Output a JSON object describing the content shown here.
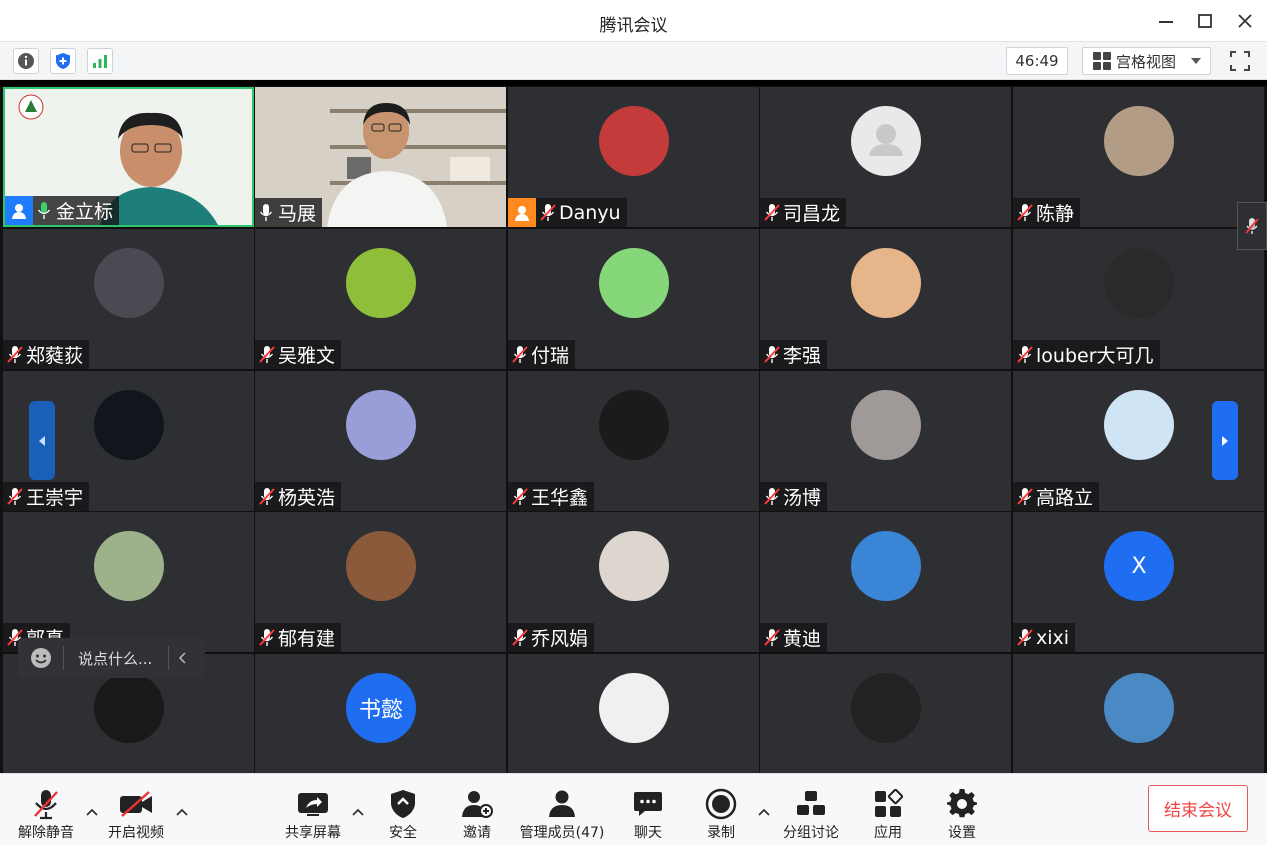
{
  "window": {
    "title": "腾讯会议"
  },
  "infobar": {
    "timer": "46:49",
    "view_mode": "宫格视图"
  },
  "participants": [
    {
      "name": "金立标",
      "mic": "on",
      "host": true,
      "video": true,
      "host_color": "#1f7cff"
    },
    {
      "name": "马展",
      "mic": "on",
      "host": false,
      "video": true
    },
    {
      "name": "Danyu",
      "mic": "off",
      "host": true,
      "host_color": "#ff8a1f",
      "avatar_bg": "#c43b3b"
    },
    {
      "name": "司昌龙",
      "mic": "off",
      "avatar_bg": "#e9e9e9"
    },
    {
      "name": "陈静",
      "mic": "off",
      "avatar_bg": "#b39c86"
    },
    {
      "name": "郑蕤荻",
      "mic": "off",
      "avatar_bg": "#4b4a52"
    },
    {
      "name": "吴雅文",
      "mic": "off",
      "avatar_bg": "#8fbf3a"
    },
    {
      "name": "付瑞",
      "mic": "off",
      "avatar_bg": "#86d67a"
    },
    {
      "name": "李强",
      "mic": "off",
      "avatar_bg": "#e7b58a"
    },
    {
      "name": "louber大可几",
      "mic": "off",
      "avatar_bg": "#2a2a2a"
    },
    {
      "name": "王崇宇",
      "mic": "off",
      "avatar_bg": "#11161d"
    },
    {
      "name": "杨英浩",
      "mic": "off",
      "avatar_bg": "#9a9ed8"
    },
    {
      "name": "王华鑫",
      "mic": "off",
      "avatar_bg": "#1b1b1b"
    },
    {
      "name": "汤博",
      "mic": "off",
      "avatar_bg": "#9f9a98"
    },
    {
      "name": "高路立",
      "mic": "off",
      "avatar_bg": "#cfe4f5"
    },
    {
      "name": "郭真",
      "mic": "off",
      "avatar_bg": "#9db28a"
    },
    {
      "name": "郁有建",
      "mic": "off",
      "avatar_bg": "#8a5a3a"
    },
    {
      "name": "乔风娟",
      "mic": "off",
      "avatar_bg": "#dcd6cf"
    },
    {
      "name": "黄迪",
      "mic": "off",
      "avatar_bg": "#3a85d6"
    },
    {
      "name": "xixi",
      "mic": "off",
      "avatar_bg": "#1f6ef2",
      "avatar_letter": "X"
    },
    {
      "name": "",
      "mic": "off",
      "avatar_bg": "#1a1819"
    },
    {
      "name": "",
      "mic": "off",
      "avatar_bg": "#1f6ef2",
      "avatar_letter": "书懿"
    },
    {
      "name": "",
      "mic": "off",
      "avatar_bg": "#f0f0f0"
    },
    {
      "name": "",
      "mic": "off",
      "avatar_bg": "#222"
    },
    {
      "name": "",
      "mic": "off",
      "avatar_bg": "#4a8ac4"
    }
  ],
  "chat": {
    "placeholder": "说点什么..."
  },
  "toolbar": {
    "unmute": "解除静音",
    "start_video": "开启视频",
    "share_screen": "共享屏幕",
    "security": "安全",
    "invite": "邀请",
    "manage_members": "管理成员(47)",
    "chat": "聊天",
    "record": "录制",
    "breakout": "分组讨论",
    "apps": "应用",
    "settings": "设置",
    "end_meeting": "结束会议"
  },
  "colors": {
    "accent": "#1f6ef2",
    "end": "#e44444",
    "tile_bg": "#2d2f33"
  }
}
